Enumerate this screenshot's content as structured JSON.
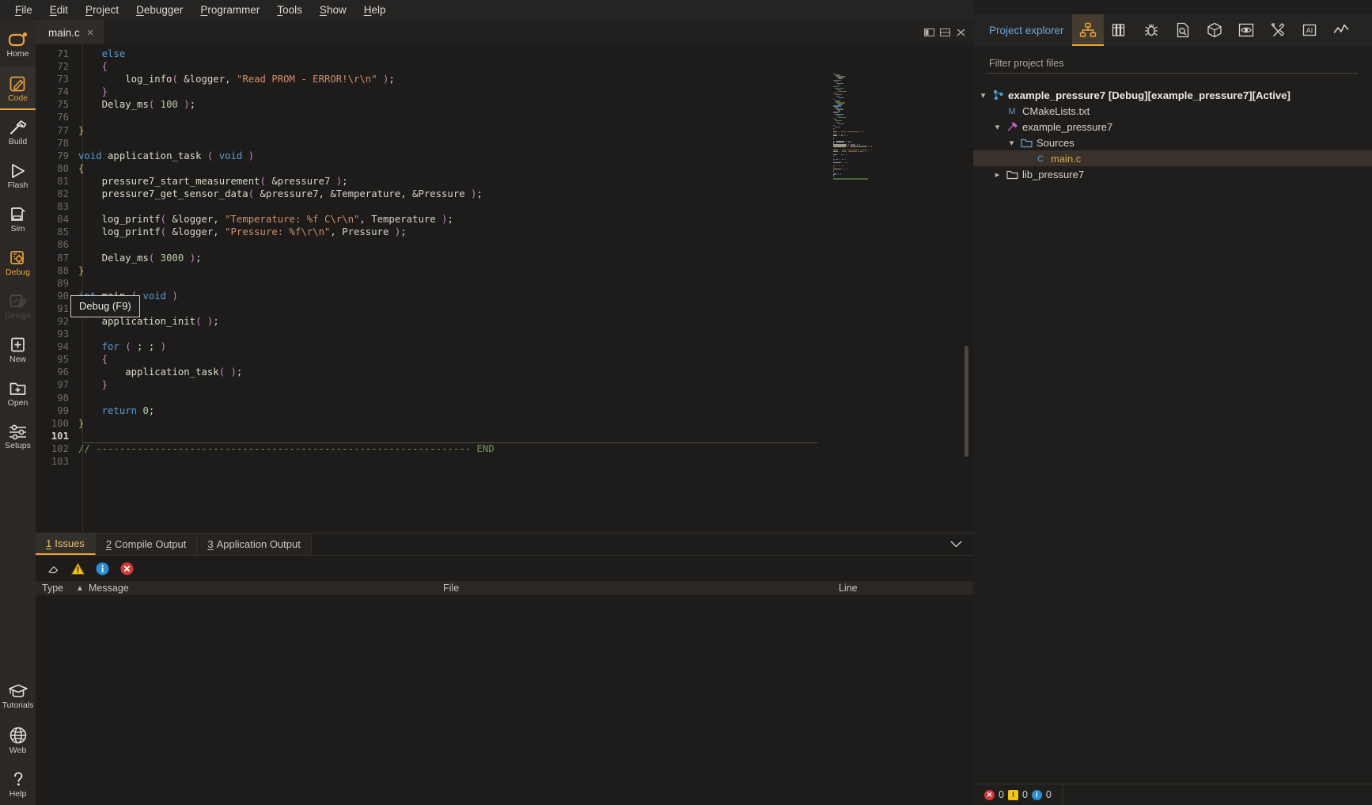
{
  "menubar": {
    "items": [
      {
        "label": "File",
        "mnemonic": "F"
      },
      {
        "label": "Edit",
        "mnemonic": "E"
      },
      {
        "label": "Project",
        "mnemonic": "P"
      },
      {
        "label": "Debugger",
        "mnemonic": "D"
      },
      {
        "label": "Programmer",
        "mnemonic": "P"
      },
      {
        "label": "Tools",
        "mnemonic": "T"
      },
      {
        "label": "Show",
        "mnemonic": "S"
      },
      {
        "label": "Help",
        "mnemonic": "H"
      }
    ]
  },
  "rail": {
    "items": [
      {
        "label": "Home",
        "icon": "home-icon",
        "state": "normal"
      },
      {
        "label": "Code",
        "icon": "code-pencil-icon",
        "state": "active"
      },
      {
        "label": "Build",
        "icon": "hammer-icon",
        "state": "normal"
      },
      {
        "label": "Flash",
        "icon": "play-triangle-icon",
        "state": "normal"
      },
      {
        "label": "Sim",
        "icon": "simulator-icon",
        "state": "normal"
      },
      {
        "label": "Debug",
        "icon": "debug-bug-icon",
        "state": "accent"
      },
      {
        "label": "Design",
        "icon": "design-pencil-icon",
        "state": "disabled"
      },
      {
        "label": "New",
        "icon": "new-file-plus-icon",
        "state": "normal"
      },
      {
        "label": "Open",
        "icon": "open-folder-plus-icon",
        "state": "normal"
      },
      {
        "label": "Setups",
        "icon": "sliders-icon",
        "state": "normal"
      },
      {
        "label": "Tutorials",
        "icon": "graduation-cap-icon",
        "state": "normal"
      },
      {
        "label": "Web",
        "icon": "globe-icon",
        "state": "normal"
      },
      {
        "label": "Help",
        "icon": "question-mark-icon",
        "state": "normal"
      }
    ]
  },
  "editor": {
    "tab": {
      "label": "main.c",
      "close": "×"
    },
    "window_controls": [
      "split-vertical-icon",
      "split-horizontal-icon",
      "close-icon"
    ],
    "tooltip": "Debug (F9)",
    "cursor_line": 101,
    "first_line": 71,
    "last_line": 103,
    "lines": [
      {
        "n": 71,
        "tokens": [
          {
            "t": "    ",
            "c": "pl"
          },
          {
            "t": "else",
            "c": "k"
          }
        ]
      },
      {
        "n": 72,
        "tokens": [
          {
            "t": "    ",
            "c": "pl"
          },
          {
            "t": "{",
            "c": "p"
          }
        ]
      },
      {
        "n": 73,
        "tokens": [
          {
            "t": "        ",
            "c": "pl"
          },
          {
            "t": "log_info",
            "c": "fn"
          },
          {
            "t": "(",
            "c": "p"
          },
          {
            "t": " &logger, ",
            "c": "pl"
          },
          {
            "t": "\"Read PROM - ERROR!\\r\\n\"",
            "c": "st"
          },
          {
            "t": " )",
            "c": "p"
          },
          {
            "t": ";",
            "c": "pl"
          }
        ]
      },
      {
        "n": 74,
        "tokens": [
          {
            "t": "    ",
            "c": "pl"
          },
          {
            "t": "}",
            "c": "p"
          }
        ]
      },
      {
        "n": 75,
        "tokens": [
          {
            "t": "    ",
            "c": "pl"
          },
          {
            "t": "Delay_ms",
            "c": "fn"
          },
          {
            "t": "(",
            "c": "p"
          },
          {
            "t": " ",
            "c": "pl"
          },
          {
            "t": "100",
            "c": "num"
          },
          {
            "t": " )",
            "c": "p"
          },
          {
            "t": ";",
            "c": "pl"
          }
        ]
      },
      {
        "n": 76,
        "tokens": []
      },
      {
        "n": 77,
        "tokens": [
          {
            "t": "}",
            "c": "y"
          }
        ]
      },
      {
        "n": 78,
        "tokens": []
      },
      {
        "n": 79,
        "tokens": [
          {
            "t": "void",
            "c": "k"
          },
          {
            "t": " ",
            "c": "pl"
          },
          {
            "t": "application_task",
            "c": "fn"
          },
          {
            "t": " (",
            "c": "p"
          },
          {
            "t": " ",
            "c": "pl"
          },
          {
            "t": "void",
            "c": "k"
          },
          {
            "t": " )",
            "c": "p"
          }
        ]
      },
      {
        "n": 80,
        "tokens": [
          {
            "t": "{",
            "c": "y"
          }
        ]
      },
      {
        "n": 81,
        "tokens": [
          {
            "t": "    ",
            "c": "pl"
          },
          {
            "t": "pressure7_start_measurement",
            "c": "fn"
          },
          {
            "t": "(",
            "c": "p"
          },
          {
            "t": " &pressure7",
            "c": "pl"
          },
          {
            "t": " )",
            "c": "p"
          },
          {
            "t": ";",
            "c": "pl"
          }
        ]
      },
      {
        "n": 82,
        "tokens": [
          {
            "t": "    ",
            "c": "pl"
          },
          {
            "t": "pressure7_get_sensor_data",
            "c": "fn"
          },
          {
            "t": "(",
            "c": "p"
          },
          {
            "t": " &pressure7, &Temperature, &Pressure",
            "c": "pl"
          },
          {
            "t": " )",
            "c": "p"
          },
          {
            "t": ";",
            "c": "pl"
          }
        ]
      },
      {
        "n": 83,
        "tokens": []
      },
      {
        "n": 84,
        "tokens": [
          {
            "t": "    ",
            "c": "pl"
          },
          {
            "t": "log_printf",
            "c": "fn"
          },
          {
            "t": "(",
            "c": "p"
          },
          {
            "t": " &logger, ",
            "c": "pl"
          },
          {
            "t": "\"Temperature: %f C\\r\\n\"",
            "c": "st"
          },
          {
            "t": ", Temperature",
            "c": "pl"
          },
          {
            "t": " )",
            "c": "p"
          },
          {
            "t": ";",
            "c": "pl"
          }
        ]
      },
      {
        "n": 85,
        "tokens": [
          {
            "t": "    ",
            "c": "pl"
          },
          {
            "t": "log_printf",
            "c": "fn"
          },
          {
            "t": "(",
            "c": "p"
          },
          {
            "t": " &logger, ",
            "c": "pl"
          },
          {
            "t": "\"Pressure: %f\\r\\n\"",
            "c": "st"
          },
          {
            "t": ", Pressure",
            "c": "pl"
          },
          {
            "t": " )",
            "c": "p"
          },
          {
            "t": ";",
            "c": "pl"
          }
        ]
      },
      {
        "n": 86,
        "tokens": []
      },
      {
        "n": 87,
        "tokens": [
          {
            "t": "    ",
            "c": "pl"
          },
          {
            "t": "Delay_ms",
            "c": "fn"
          },
          {
            "t": "(",
            "c": "p"
          },
          {
            "t": " ",
            "c": "pl"
          },
          {
            "t": "3000",
            "c": "num"
          },
          {
            "t": " )",
            "c": "p"
          },
          {
            "t": ";",
            "c": "pl"
          }
        ]
      },
      {
        "n": 88,
        "tokens": [
          {
            "t": "}",
            "c": "y"
          }
        ]
      },
      {
        "n": 89,
        "tokens": []
      },
      {
        "n": 90,
        "tokens": [
          {
            "t": "int",
            "c": "k"
          },
          {
            "t": " ",
            "c": "pl"
          },
          {
            "t": "main",
            "c": "fn"
          },
          {
            "t": " (",
            "c": "p"
          },
          {
            "t": " ",
            "c": "pl"
          },
          {
            "t": "void",
            "c": "k"
          },
          {
            "t": " )",
            "c": "p"
          }
        ]
      },
      {
        "n": 91,
        "tokens": [
          {
            "t": "{",
            "c": "y"
          }
        ]
      },
      {
        "n": 92,
        "tokens": [
          {
            "t": "    ",
            "c": "pl"
          },
          {
            "t": "application_init",
            "c": "fn"
          },
          {
            "t": "(",
            "c": "p"
          },
          {
            "t": " )",
            "c": "p"
          },
          {
            "t": ";",
            "c": "pl"
          }
        ]
      },
      {
        "n": 93,
        "tokens": []
      },
      {
        "n": 94,
        "tokens": [
          {
            "t": "    ",
            "c": "pl"
          },
          {
            "t": "for",
            "c": "k"
          },
          {
            "t": " (",
            "c": "p"
          },
          {
            "t": " ; ; ",
            "c": "pl"
          },
          {
            "t": ")",
            "c": "p"
          }
        ]
      },
      {
        "n": 95,
        "tokens": [
          {
            "t": "    ",
            "c": "pl"
          },
          {
            "t": "{",
            "c": "p"
          }
        ]
      },
      {
        "n": 96,
        "tokens": [
          {
            "t": "        ",
            "c": "pl"
          },
          {
            "t": "application_task",
            "c": "fn"
          },
          {
            "t": "(",
            "c": "p"
          },
          {
            "t": " )",
            "c": "p"
          },
          {
            "t": ";",
            "c": "pl"
          }
        ]
      },
      {
        "n": 97,
        "tokens": [
          {
            "t": "    ",
            "c": "pl"
          },
          {
            "t": "}",
            "c": "p"
          }
        ]
      },
      {
        "n": 98,
        "tokens": []
      },
      {
        "n": 99,
        "tokens": [
          {
            "t": "    ",
            "c": "pl"
          },
          {
            "t": "return",
            "c": "k"
          },
          {
            "t": " ",
            "c": "pl"
          },
          {
            "t": "0",
            "c": "num"
          },
          {
            "t": ";",
            "c": "pl"
          }
        ]
      },
      {
        "n": 100,
        "tokens": [
          {
            "t": "}",
            "c": "y"
          }
        ]
      },
      {
        "n": 101,
        "tokens": []
      },
      {
        "n": 102,
        "tokens": [
          {
            "t": "// ---------------------------------------------------------------- END",
            "c": "cm"
          }
        ]
      },
      {
        "n": 103,
        "tokens": []
      }
    ]
  },
  "bottom_panel": {
    "tabs": [
      {
        "number": "1",
        "label": "Issues",
        "active": true
      },
      {
        "number": "2",
        "label": "Compile Output",
        "active": false
      },
      {
        "number": "3",
        "label": "Application Output",
        "active": false
      }
    ],
    "toolbar": [
      {
        "icon": "eraser-clear-icon",
        "name": "clear-issues-button"
      },
      {
        "icon": "warning-triangle-icon",
        "name": "filter-warnings-button"
      },
      {
        "icon": "info-circle-icon",
        "name": "filter-info-button"
      },
      {
        "icon": "error-circle-icon",
        "name": "filter-errors-button"
      }
    ],
    "columns": [
      "Type",
      "Message",
      "File",
      "Line"
    ],
    "rows": []
  },
  "right_panel": {
    "title": "Project explorer",
    "icons": [
      {
        "name": "project-explorer-icon",
        "active": true
      },
      {
        "name": "library-manager-icon",
        "active": false
      },
      {
        "name": "debug-bug-icon",
        "active": false
      },
      {
        "name": "file-search-icon",
        "active": false
      },
      {
        "name": "package-cube-icon",
        "active": false
      },
      {
        "name": "eye-monitor-icon",
        "active": false
      },
      {
        "name": "tools-wrench-icon",
        "active": false
      },
      {
        "name": "ai-assistant-icon",
        "active": false
      },
      {
        "name": "chart-line-icon",
        "active": false
      }
    ],
    "filter_placeholder": "Filter project files",
    "filter_value": "",
    "tree": [
      {
        "depth": 0,
        "twist": "expanded",
        "icon": "project-node-icon",
        "label": "example_pressure7 [Debug][example_pressure7][Active]",
        "root": true,
        "selected": false
      },
      {
        "depth": 1,
        "twist": "none",
        "icon": "cmake-m-icon",
        "label": "CMakeLists.txt",
        "root": false,
        "selected": false
      },
      {
        "depth": 1,
        "twist": "expanded",
        "icon": "build-target-icon",
        "label": "example_pressure7",
        "root": false,
        "selected": false
      },
      {
        "depth": 2,
        "twist": "expanded",
        "icon": "folder-icon",
        "label": "Sources",
        "root": false,
        "selected": false
      },
      {
        "depth": 3,
        "twist": "none",
        "icon": "c-file-icon",
        "label": "main.c",
        "root": false,
        "selected": true
      },
      {
        "depth": 1,
        "twist": "collapsed",
        "icon": "folder-icon",
        "label": "lib_pressure7",
        "root": false,
        "selected": false
      }
    ],
    "status": {
      "errors": "0",
      "warnings": "0",
      "infos": "0"
    }
  },
  "colors": {
    "accent": "#e8a33d",
    "panel_title": "#6aa7dd",
    "error": "#cf3a3a",
    "warning": "#f0c419",
    "info": "#2a8fd8",
    "background": "#1e1c1a"
  }
}
